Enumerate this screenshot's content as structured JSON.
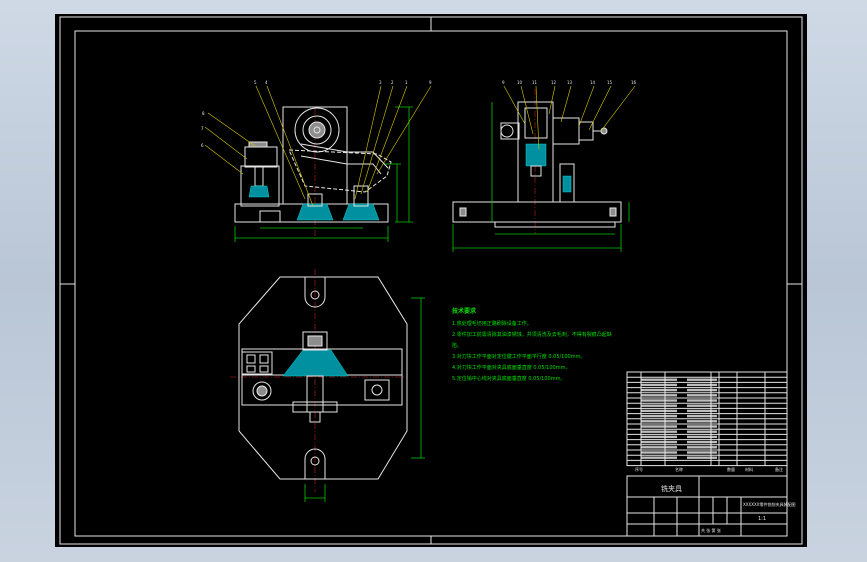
{
  "tech_requirements": {
    "title": "技术要求",
    "lines": [
      "1.热处理毛坯用正路刷除设备工作。",
      "2.零件加工前需清除其油漆锈蚀，并须清洗及去毛刺，不得有裂痕凸起缺",
      "陷。",
      "3.对刀块工作平面对定位键工作平面平行度 0.05/100mm。",
      "4.对刀块工作平面对夹具底面垂直度 0.05/100mm。",
      "5.定位销中心线对夹具底面垂直度 0.05/100mm。"
    ]
  },
  "balloons_front": [
    "8",
    "7",
    "6",
    "5",
    "4",
    "3",
    "2",
    "1",
    "9",
    "10"
  ],
  "balloons_side": [
    "9",
    "10",
    "11",
    "12",
    "13",
    "14",
    "15",
    "16"
  ],
  "title_block": {
    "drawing_name": "铣夹具",
    "title_right": "XXXXXX零件铣削夹具装配图",
    "scale": "1:1",
    "sheet_info": "共 张 第 张",
    "header_cols": [
      "序号",
      "名称",
      "数量",
      "材料",
      "备注"
    ]
  }
}
